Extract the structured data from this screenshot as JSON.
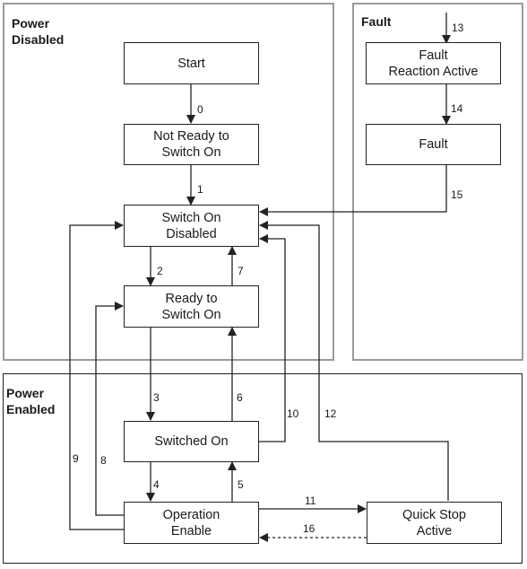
{
  "regions": {
    "power_disabled": "Power\nDisabled",
    "fault": "Fault",
    "power_enabled": "Power\nEnabled"
  },
  "states": {
    "start": "Start",
    "not_ready": "Not Ready to\nSwitch On",
    "switch_on_disabled": "Switch On\nDisabled",
    "ready": "Ready to\nSwitch On",
    "switched_on": "Switched On",
    "operation_enable": "Operation\nEnable",
    "quick_stop": "Quick Stop\nActive",
    "fault_reaction": "Fault\nReaction Active",
    "fault": "Fault"
  },
  "transitions": [
    "0",
    "1",
    "2",
    "3",
    "4",
    "5",
    "6",
    "7",
    "8",
    "9",
    "10",
    "11",
    "12",
    "13",
    "14",
    "15",
    "16"
  ],
  "colors": {
    "line": "#222222",
    "region_border_gray": "#9a9a9a"
  }
}
